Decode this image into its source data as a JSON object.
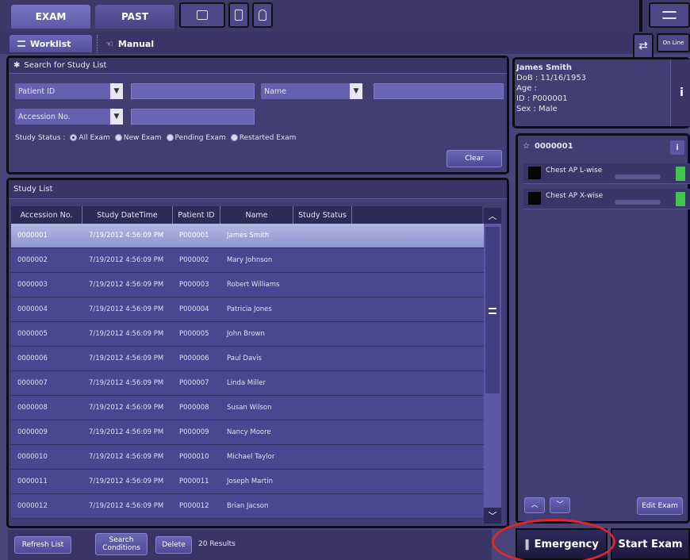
{
  "top_tabs": [
    {
      "label": "EXAM",
      "active": true
    },
    {
      "label": "PAST",
      "active": false
    }
  ],
  "sub_tabs": [
    {
      "label": "Worklist",
      "active": true
    },
    {
      "label": "Manual",
      "active": false
    }
  ],
  "online_label": "On Line",
  "search": {
    "title": "Search for Study List",
    "field1_label": "Patient ID",
    "field2_label": "Name",
    "field3_label": "Accession No.",
    "status_label": "Study Status :",
    "options": [
      "All Exam",
      "New Exam",
      "Pending Exam",
      "Restarted Exam"
    ],
    "clear_label": "Clear"
  },
  "study_list": {
    "title": "Study List",
    "columns": [
      "Accession No.",
      "Study DateTime",
      "Patient ID",
      "Name",
      "Study Status"
    ],
    "rows": [
      [
        "0000001",
        "7/19/2012 4:56:09 PM",
        "P000001",
        "James Smith",
        ""
      ],
      [
        "0000002",
        "7/19/2012 4:56:09 PM",
        "P000002",
        "Mary Johnson",
        ""
      ],
      [
        "0000003",
        "7/19/2012 4:56:09 PM",
        "P000003",
        "Robert Williams",
        ""
      ],
      [
        "0000004",
        "7/19/2012 4:56:09 PM",
        "P000004",
        "Patricia Jones",
        ""
      ],
      [
        "0000005",
        "7/19/2012 4:56:09 PM",
        "P000005",
        "John Brown",
        ""
      ],
      [
        "0000006",
        "7/19/2012 4:56:09 PM",
        "P000006",
        "Paul Davis",
        ""
      ],
      [
        "0000007",
        "7/19/2012 4:56:09 PM",
        "P000007",
        "Linda Miller",
        ""
      ],
      [
        "0000008",
        "7/19/2012 4:56:09 PM",
        "P000008",
        "Susan Wilson",
        ""
      ],
      [
        "0000009",
        "7/19/2012 4:56:09 PM",
        "P000009",
        "Nancy Moore",
        ""
      ],
      [
        "0000010",
        "7/19/2012 4:56:09 PM",
        "P000010",
        "Michael Taylor",
        ""
      ],
      [
        "0000011",
        "7/19/2012 4:56:09 PM",
        "P000011",
        "Joseph Martin",
        ""
      ],
      [
        "0000012",
        "7/19/2012 4:56:09 PM",
        "P000012",
        "Brian Jacson",
        ""
      ]
    ]
  },
  "bottom": {
    "refresh_label": "Refresh List",
    "search_cond_label": "Search Conditions",
    "delete_label": "Delete",
    "results": "20 Results"
  },
  "patient": {
    "name": "James Smith",
    "dob": "DoB : 11/16/1953",
    "age": "Age :",
    "id": "ID : P000001",
    "sex": "Sex : Male"
  },
  "exam": {
    "accession": "0000001",
    "sequences": [
      "Chest AP L-wise",
      "Chest AP X-wise"
    ],
    "edit_label": "Edit Exam"
  },
  "actions": {
    "emergency_label": "Emergency",
    "start_label": "Start Exam"
  },
  "colors": {
    "background": "#4a4578",
    "selected_row": "#9aa1d8",
    "status_green": "#3ec64c",
    "emergency_ring": "#e0252b"
  }
}
